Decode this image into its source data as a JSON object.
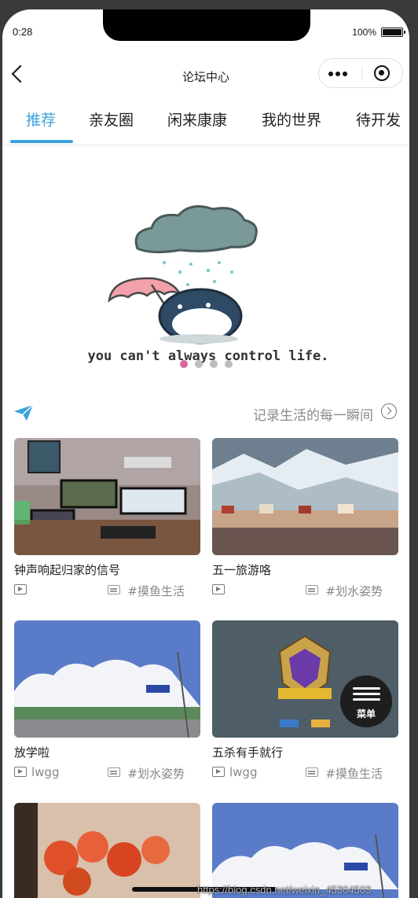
{
  "status_bar": {
    "time": "0:28",
    "battery": "100%"
  },
  "navbar": {
    "title": "论坛中心"
  },
  "tabs": [
    {
      "label": "推荐",
      "active": true
    },
    {
      "label": "亲友圈"
    },
    {
      "label": "闲来康康"
    },
    {
      "label": "我的世界"
    },
    {
      "label": "待开发"
    }
  ],
  "banner": {
    "caption": "you can't always control life.",
    "slide_count": 4,
    "active_slide": 1
  },
  "section": {
    "link_text": "记录生活的每一瞬间"
  },
  "cards": [
    {
      "title": "钟声响起归家的信号",
      "author": "",
      "tag": "#摸鱼生活"
    },
    {
      "title": "五一旅游咯",
      "author": "",
      "tag": "#划水姿势"
    },
    {
      "title": "放学啦",
      "author": "lwgg",
      "tag": "#划水姿势"
    },
    {
      "title": "五杀有手就行",
      "author": "lwgg",
      "tag": "#摸鱼生活"
    }
  ],
  "menu_button": {
    "label": "菜单"
  },
  "watermark": "https://blog.csdn.net/weixin_45304503",
  "colors": {
    "accent": "#3aa4db",
    "active_dot": "#d9679a"
  }
}
